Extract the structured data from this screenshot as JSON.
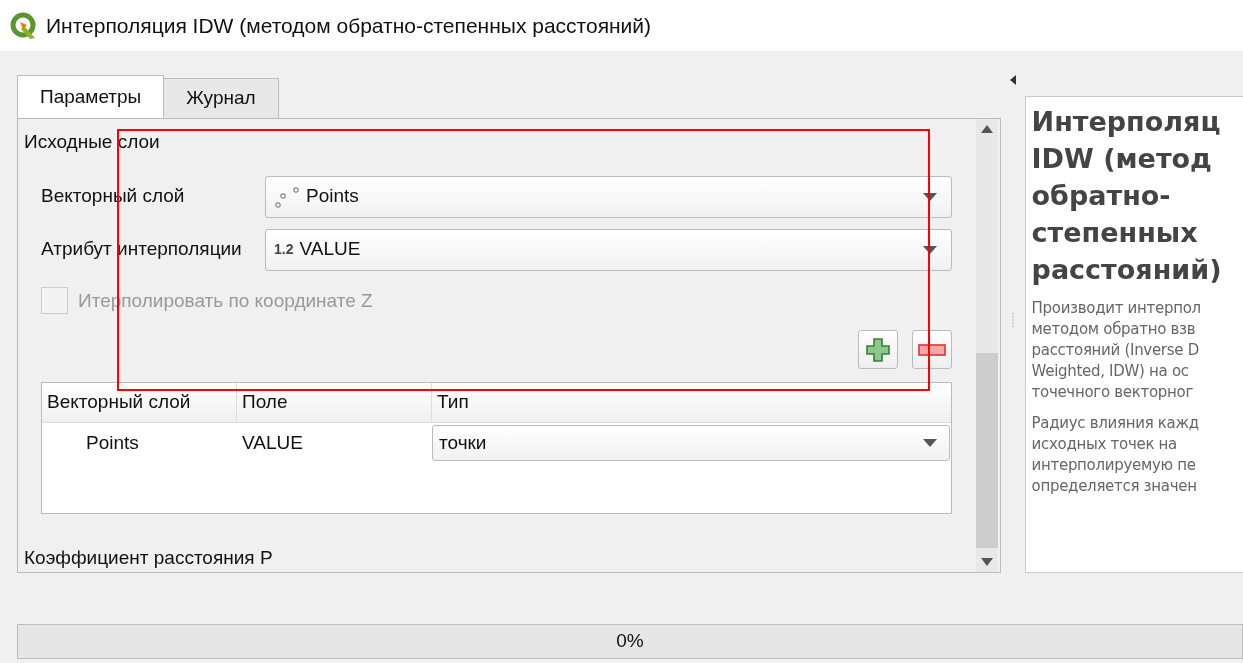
{
  "window": {
    "title": "Интерполяция IDW (методом обратно-степенных расстояний)"
  },
  "tabs": [
    {
      "label": "Параметры",
      "selected": true
    },
    {
      "label": "Журнал",
      "selected": false
    }
  ],
  "section_title": "Исходные слои",
  "fields": [
    {
      "label": "Векторный слой",
      "value": "Points",
      "kind": "layer"
    },
    {
      "label": "Атрибут интерполяции",
      "value": "VALUE",
      "kind": "attribute",
      "icon_text": "1.2"
    }
  ],
  "z_checkbox": {
    "label": "Итерполировать по координате Z",
    "checked": false,
    "disabled": true
  },
  "table": {
    "columns": [
      "Векторный слой",
      "Поле",
      "Тип"
    ],
    "rows": [
      {
        "layer": "Points",
        "field": "VALUE",
        "type": "точки"
      }
    ]
  },
  "next_section": "Коэффициент расстояния P",
  "help": {
    "title_lines": [
      "Интерполяц",
      "IDW (метод",
      "обратно-",
      "степенных",
      "расстояний)"
    ],
    "paragraphs": [
      [
        "Производит интерпол",
        "методом обратно взв",
        "расстояний (Inverse D",
        "Weighted, IDW) на ос",
        "точечного векторног"
      ],
      [
        "Радиус влияния кажд",
        "исходных точек на",
        "интерполируемую пе",
        "определяется значен"
      ]
    ]
  },
  "progress": {
    "level": 0,
    "label": "0%"
  }
}
